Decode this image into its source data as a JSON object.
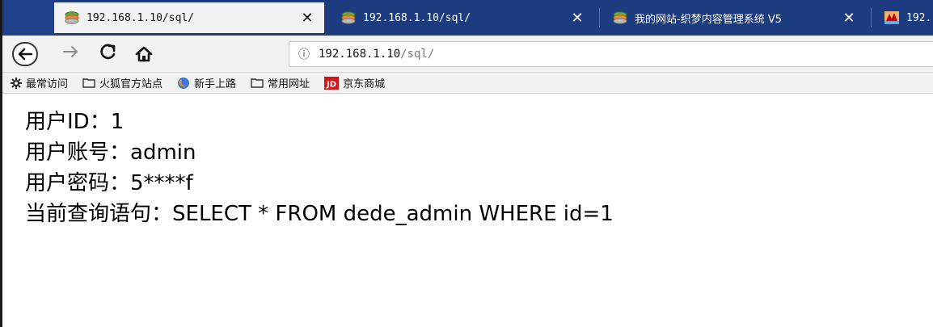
{
  "browser": {
    "tabs": [
      {
        "title": "192.168.1.10/sql/",
        "active": true,
        "icon": "layers-icon"
      },
      {
        "title": "192.168.1.10/sql/",
        "active": false,
        "icon": "layers-icon"
      },
      {
        "title": "我的网站-织梦内容管理系统 V5",
        "active": false,
        "icon": "layers-icon"
      },
      {
        "title": "192.",
        "active": false,
        "icon": "php-logo-icon"
      }
    ],
    "url": {
      "host": "192.168.1.10",
      "path": "/sql/"
    },
    "bookmarks": [
      {
        "label": "最常访问",
        "icon": "gear-icon"
      },
      {
        "label": "火狐官方站点",
        "icon": "folder-icon"
      },
      {
        "label": "新手上路",
        "icon": "firefox-icon"
      },
      {
        "label": "常用网址",
        "icon": "folder-icon"
      },
      {
        "label": "京东商城",
        "icon": "jd-logo-icon"
      }
    ],
    "colors": {
      "tabstrip": "#1d3c80",
      "active_tab": "#f2f2f2",
      "toolbar": "#f2f2f2",
      "jd_red": "#d7141a"
    }
  },
  "page": {
    "lines": [
      {
        "label": "用户ID：",
        "value": "1"
      },
      {
        "label": "用户账号：",
        "value": "admin"
      },
      {
        "label": "用户密码：",
        "value": "5****f"
      },
      {
        "label": "当前查询语句：",
        "value": "SELECT * FROM dede_admin WHERE id=1"
      }
    ]
  }
}
